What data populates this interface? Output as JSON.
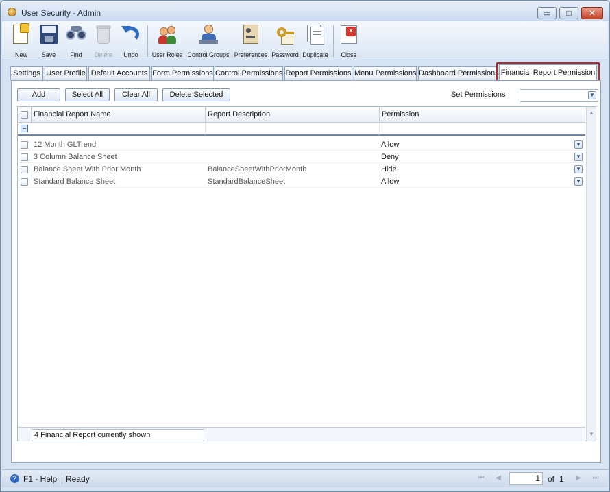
{
  "window": {
    "title": "User Security - Admin"
  },
  "window_controls": {
    "minimize": "▭",
    "maximize": "□",
    "close": "✕"
  },
  "toolbar": {
    "items": [
      {
        "id": "new",
        "label": "New",
        "icon": "new-document-icon",
        "enabled": true
      },
      {
        "id": "save",
        "label": "Save",
        "icon": "floppy-disk-icon",
        "enabled": true
      },
      {
        "id": "find",
        "label": "Find",
        "icon": "binoculars-icon",
        "enabled": true
      },
      {
        "id": "delete",
        "label": "Delete",
        "icon": "trash-can-icon",
        "enabled": false
      },
      {
        "id": "undo",
        "label": "Undo",
        "icon": "undo-arrow-icon",
        "enabled": true
      },
      {
        "id": "user_roles",
        "label": "User Roles",
        "icon": "users-icon",
        "enabled": true
      },
      {
        "id": "control_groups",
        "label": "Control Groups",
        "icon": "user-workstation-icon",
        "enabled": true
      },
      {
        "id": "preferences",
        "label": "Preferences",
        "icon": "preferences-panel-icon",
        "enabled": true
      },
      {
        "id": "password",
        "label": "Password",
        "icon": "key-icon",
        "enabled": true
      },
      {
        "id": "duplicate",
        "label": "Duplicate",
        "icon": "duplicate-pages-icon",
        "enabled": true
      },
      {
        "id": "close",
        "label": "Close",
        "icon": "close-window-icon",
        "enabled": true
      }
    ]
  },
  "tabs": [
    {
      "label": "Settings",
      "active": false
    },
    {
      "label": "User Profile",
      "active": false
    },
    {
      "label": "Default Accounts",
      "active": false
    },
    {
      "label": "Form Permissions",
      "active": false
    },
    {
      "label": "Control Permissions",
      "active": false
    },
    {
      "label": "Report Permissions",
      "active": false
    },
    {
      "label": "Menu Permissions",
      "active": false
    },
    {
      "label": "Dashboard Permissions",
      "active": false
    },
    {
      "label": "Financial Report Permission",
      "active": true
    }
  ],
  "actions": {
    "add": "Add",
    "select_all": "Select All",
    "clear_all": "Clear All",
    "delete_selected": "Delete Selected",
    "set_permissions_label": "Set Permissions",
    "set_permissions_value": ""
  },
  "grid": {
    "columns": [
      "Financial Report Name",
      "Report Description",
      "Permission"
    ],
    "rows": [
      {
        "name": "12 Month GLTrend",
        "description": "",
        "permission": "Allow"
      },
      {
        "name": "3 Column Balance Sheet",
        "description": "",
        "permission": "Deny"
      },
      {
        "name": "Balance Sheet With Prior Month",
        "description": "BalanceSheetWithPriorMonth",
        "permission": "Hide"
      },
      {
        "name": "Standard Balance Sheet",
        "description": "StandardBalanceSheet",
        "permission": "Allow"
      }
    ],
    "footer": "4 Financial Report currently shown"
  },
  "statusbar": {
    "help": "F1 - Help",
    "status": "Ready",
    "page": "1",
    "of_label": "of",
    "total_pages": "1"
  },
  "colors": {
    "tab_highlight": "#b8272b",
    "accent": "#2e6bc2",
    "window_bg": "#d6e3f3"
  }
}
